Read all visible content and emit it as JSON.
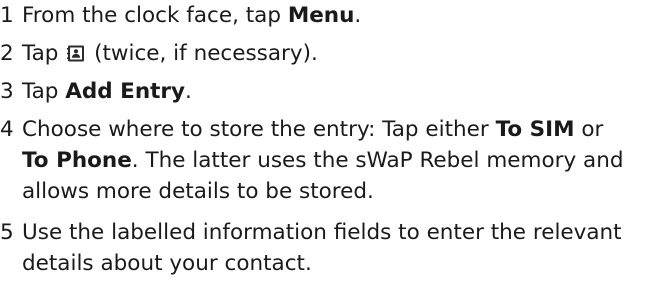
{
  "steps": [
    {
      "num": "1",
      "pre": "From the clock face, tap ",
      "bold": "Menu",
      "post": "."
    },
    {
      "num": "2",
      "pre": "Tap",
      "icon": "contacts-icon",
      "post": "(twice, if necessary)."
    },
    {
      "num": "3",
      "pre": "Tap ",
      "bold": "Add Entry",
      "post": "."
    },
    {
      "num": "4",
      "line1_pre": "Choose where to store the entry: Tap either ",
      "line1_bold": "To SIM",
      "line1_post": " or",
      "line2_bold": "To Phone",
      "line2_post": ". The latter uses the sWaP Rebel memory and",
      "line3": "allows more details to be stored."
    },
    {
      "num": "5",
      "line1": "Use the labelled information fields to enter the relevant",
      "line2": "details about your contact."
    }
  ]
}
